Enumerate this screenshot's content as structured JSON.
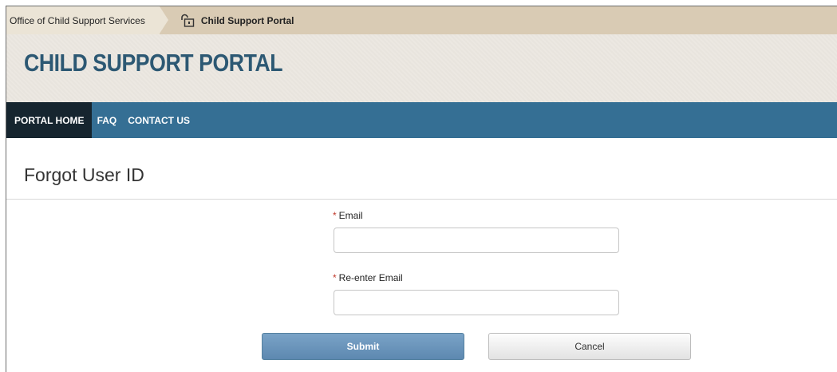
{
  "breadcrumb": {
    "parent": "Office of Child Support Services",
    "current": "Child Support Portal",
    "current_icon": "unlock-icon"
  },
  "header": {
    "site_title": "CHILD SUPPORT PORTAL"
  },
  "nav": {
    "items": [
      {
        "label": "PORTAL HOME",
        "active": true
      },
      {
        "label": "FAQ",
        "active": false
      },
      {
        "label": "CONTACT US",
        "active": false
      }
    ]
  },
  "page": {
    "title": "Forgot User ID"
  },
  "form": {
    "required_marker": "*",
    "email": {
      "label": "Email",
      "value": "",
      "placeholder": ""
    },
    "confirm_email": {
      "label": "Re-enter Email",
      "value": "",
      "placeholder": ""
    },
    "submit_label": "Submit",
    "cancel_label": "Cancel"
  },
  "colors": {
    "nav_bg": "#356f94",
    "nav_active_bg": "#16252f",
    "title_color": "#2c5873",
    "breadcrumb_bg": "#d9cbb4",
    "submit_bg": "#6d97bd"
  }
}
